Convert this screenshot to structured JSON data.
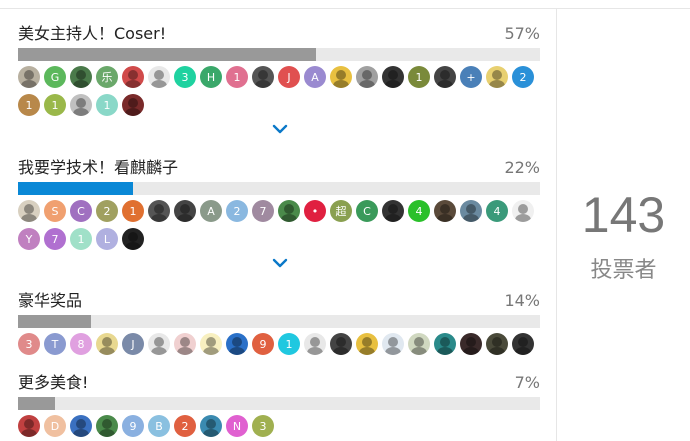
{
  "poll": {
    "options": [
      {
        "label": "美女主持人！Coser!",
        "percent_text": "57%",
        "percent": 57,
        "bar_color": "#999999",
        "voters": [
          {
            "t": "",
            "c": "#b8b0a0",
            "img": true
          },
          {
            "t": "G",
            "c": "#5cb85c"
          },
          {
            "t": "",
            "c": "#4a7a4a",
            "img": true
          },
          {
            "t": "乐",
            "c": "#6aa86a"
          },
          {
            "t": "",
            "c": "#d04a4a",
            "img": true
          },
          {
            "t": "",
            "c": "#e8e8e8",
            "img": true
          },
          {
            "t": "3",
            "c": "#1fd2a0"
          },
          {
            "t": "H",
            "c": "#3aa86a"
          },
          {
            "t": "1",
            "c": "#e07090"
          },
          {
            "t": "",
            "c": "#555555",
            "img": true
          },
          {
            "t": "J",
            "c": "#e05050"
          },
          {
            "t": "A",
            "c": "#9a8ad0"
          },
          {
            "t": "",
            "c": "#e8c040",
            "img": true
          },
          {
            "t": "",
            "c": "#a0a0a0",
            "img": true
          },
          {
            "t": "",
            "c": "#333333",
            "img": true
          },
          {
            "t": "1",
            "c": "#7a8a3a"
          },
          {
            "t": "",
            "c": "#444444",
            "img": true
          },
          {
            "t": "+",
            "c": "#4a80b8"
          },
          {
            "t": "",
            "c": "#e8d070",
            "img": true
          },
          {
            "t": "2",
            "c": "#2a90d8"
          },
          {
            "t": "1",
            "c": "#b8884a"
          },
          {
            "t": "1",
            "c": "#9ab84a"
          },
          {
            "t": "",
            "c": "#c0c0c0",
            "img": true
          },
          {
            "t": "1",
            "c": "#8ad8c8"
          },
          {
            "t": "",
            "c": "#7a2a2a",
            "img": true
          }
        ]
      },
      {
        "label": "我要学技术！看麒麟子",
        "percent_text": "22%",
        "percent": 22,
        "bar_color": "#0a88d6",
        "voters": [
          {
            "t": "",
            "c": "#d8d0c0",
            "img": true
          },
          {
            "t": "S",
            "c": "#f0a070"
          },
          {
            "t": "C",
            "c": "#a070c0"
          },
          {
            "t": "2",
            "c": "#a0a060"
          },
          {
            "t": "1",
            "c": "#e07030"
          },
          {
            "t": "",
            "c": "#555555",
            "img": true
          },
          {
            "t": "",
            "c": "#444444",
            "img": true
          },
          {
            "t": "A",
            "c": "#8a9a8a"
          },
          {
            "t": "2",
            "c": "#8ab8e0"
          },
          {
            "t": "7",
            "c": "#a08aa0"
          },
          {
            "t": "",
            "c": "#4a8a4a",
            "img": true
          },
          {
            "t": "•",
            "c": "#e02040"
          },
          {
            "t": "超",
            "c": "#8aa050"
          },
          {
            "t": "C",
            "c": "#3a9a5a"
          },
          {
            "t": "",
            "c": "#333333",
            "img": true
          },
          {
            "t": "4",
            "c": "#2ac02a"
          },
          {
            "t": "",
            "c": "#5a4a3a",
            "img": true
          },
          {
            "t": "",
            "c": "#6a8aa0",
            "img": true
          },
          {
            "t": "4",
            "c": "#3a9a7a"
          },
          {
            "t": "",
            "c": "#f0f0f0",
            "img": true
          },
          {
            "t": "Y",
            "c": "#c080c0"
          },
          {
            "t": "7",
            "c": "#b070d0"
          },
          {
            "t": "1",
            "c": "#a0e0c8"
          },
          {
            "t": "L",
            "c": "#b0b0e0"
          },
          {
            "t": "",
            "c": "#222222",
            "img": true
          }
        ]
      },
      {
        "label": "豪华奖品",
        "percent_text": "14%",
        "percent": 14,
        "bar_color": "#999999",
        "voters": [
          {
            "t": "3",
            "c": "#e08a8a"
          },
          {
            "t": "T",
            "c": "#8a9ad0"
          },
          {
            "t": "8",
            "c": "#e0a0e0"
          },
          {
            "t": "",
            "c": "#e8d890",
            "img": true
          },
          {
            "t": "J",
            "c": "#7a8aa8"
          },
          {
            "t": "",
            "c": "#e8e8e8",
            "img": true
          },
          {
            "t": "",
            "c": "#f0d0d0",
            "img": true
          },
          {
            "t": "",
            "c": "#f8f0c0",
            "img": true
          },
          {
            "t": "",
            "c": "#2a70c8",
            "img": true
          },
          {
            "t": "9",
            "c": "#e06040"
          },
          {
            "t": "1",
            "c": "#20c8e0"
          },
          {
            "t": "",
            "c": "#e8e8e8",
            "img": true
          },
          {
            "t": "",
            "c": "#444444",
            "img": true
          },
          {
            "t": "",
            "c": "#e8c040",
            "img": true
          },
          {
            "t": "",
            "c": "#e0e8f0",
            "img": true
          },
          {
            "t": "",
            "c": "#d0d8c0",
            "img": true
          },
          {
            "t": "",
            "c": "#2a8a8a",
            "img": true
          },
          {
            "t": "",
            "c": "#3a2a2a",
            "img": true
          },
          {
            "t": "",
            "c": "#4a4a3a",
            "img": true
          },
          {
            "t": "",
            "c": "#333333",
            "img": true
          }
        ]
      },
      {
        "label": "更多美食!",
        "percent_text": "7%",
        "percent": 7,
        "bar_color": "#999999",
        "voters": [
          {
            "t": "",
            "c": "#c04040",
            "img": true
          },
          {
            "t": "D",
            "c": "#f0c0a0"
          },
          {
            "t": "",
            "c": "#3a70c0",
            "img": true
          },
          {
            "t": "",
            "c": "#4a8a4a",
            "img": true
          },
          {
            "t": "9",
            "c": "#8ab0e0"
          },
          {
            "t": "B",
            "c": "#8ac0e0"
          },
          {
            "t": "2",
            "c": "#e06040"
          },
          {
            "t": "",
            "c": "#3a8ab0",
            "img": true
          },
          {
            "t": "N",
            "c": "#e060d0"
          },
          {
            "t": "3",
            "c": "#a0b050"
          }
        ]
      }
    ],
    "expand_icon_color": "#0a78c8"
  },
  "summary": {
    "voter_count": "143",
    "voter_label": "投票者"
  }
}
